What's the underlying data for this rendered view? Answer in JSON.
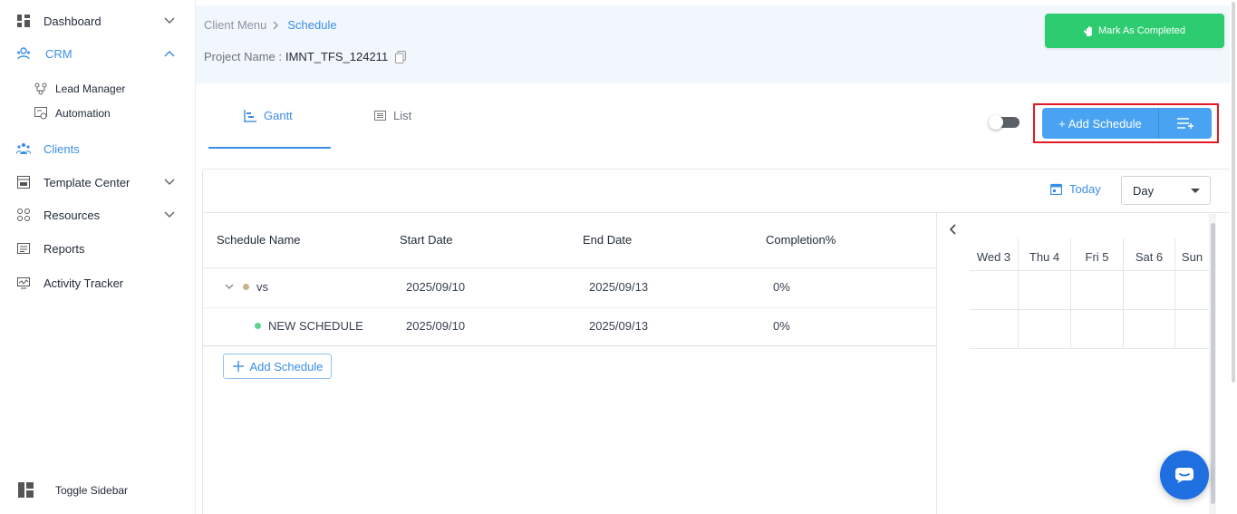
{
  "sidebar": {
    "items": [
      {
        "label": "Dashboard",
        "icon": "dashboard-icon"
      },
      {
        "label": "CRM",
        "icon": "crm-icon"
      },
      {
        "label": "Lead Manager",
        "icon": "lead-manager-icon"
      },
      {
        "label": "Automation",
        "icon": "automation-icon"
      },
      {
        "label": "Clients",
        "icon": "clients-icon"
      },
      {
        "label": "Template Center",
        "icon": "template-icon"
      },
      {
        "label": "Resources",
        "icon": "resources-icon"
      },
      {
        "label": "Reports",
        "icon": "reports-icon"
      },
      {
        "label": "Activity Tracker",
        "icon": "activity-icon"
      }
    ],
    "toggle_label": "Toggle Sidebar"
  },
  "header": {
    "breadcrumb": {
      "parent": "Client Menu",
      "current": "Schedule"
    },
    "project_label": "Project Name :",
    "project_value": "IMNT_TFS_124211",
    "mark_completed_label": "Mark As Completed"
  },
  "tabs": [
    {
      "label": "Gantt",
      "active": true
    },
    {
      "label": "List",
      "active": false
    }
  ],
  "toolbar": {
    "add_schedule_label": "+ Add Schedule",
    "today_label": "Today",
    "view_select": "Day"
  },
  "table": {
    "columns": [
      "Schedule Name",
      "Start Date",
      "End Date",
      "Completion%"
    ],
    "rows": [
      {
        "name": "vs",
        "start": "2025/09/10",
        "end": "2025/09/13",
        "completion": "0%",
        "dot_color": "#c9b48a"
      },
      {
        "name": "NEW SCHEDULE",
        "start": "2025/09/10",
        "end": "2025/09/13",
        "completion": "0%",
        "dot_color": "#5fd38d"
      }
    ],
    "add_schedule_label": "Add Schedule"
  },
  "timeline": {
    "days": [
      "Wed 3",
      "Thu 4",
      "Fri 5",
      "Sat 6",
      "Sun"
    ]
  },
  "colors": {
    "accent": "#3b8ee8",
    "success": "#2ecc71",
    "highlight": "#e01b24"
  }
}
